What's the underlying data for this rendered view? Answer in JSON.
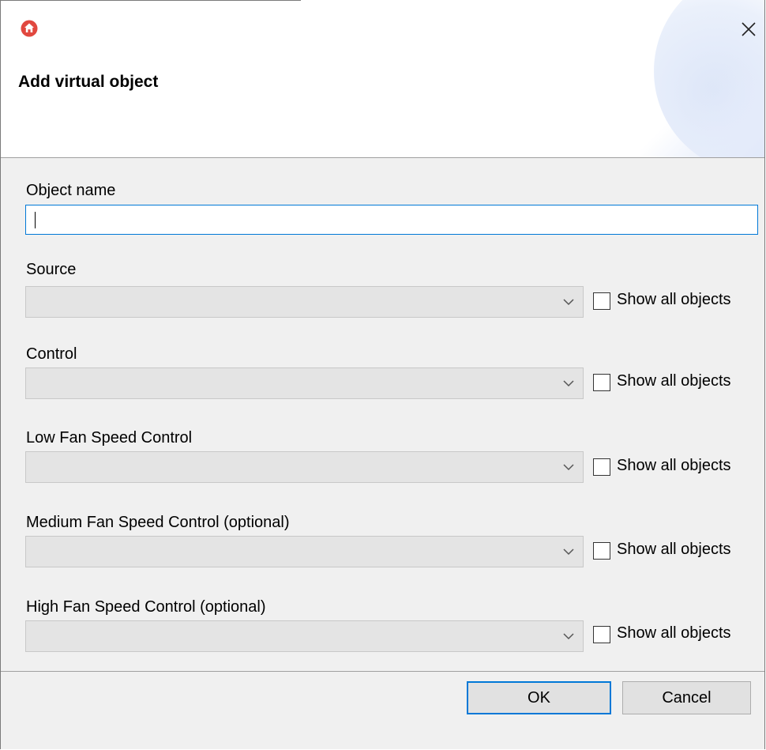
{
  "dialog": {
    "title": "Add virtual object",
    "close_glyph": "✕",
    "app_icon": "home-icon",
    "accent_color": "#e1483f"
  },
  "object_name": {
    "label": "Object name",
    "value": ""
  },
  "fields": [
    {
      "label": "Source",
      "value": "",
      "checkbox_label": "Show all objects",
      "checked": false
    },
    {
      "label": "Control",
      "value": "",
      "checkbox_label": "Show all objects",
      "checked": false
    },
    {
      "label": "Low Fan Speed Control",
      "value": "",
      "checkbox_label": "Show all objects",
      "checked": false
    },
    {
      "label": "Medium Fan Speed Control (optional)",
      "value": "",
      "checkbox_label": "Show all objects",
      "checked": false
    },
    {
      "label": "High Fan Speed Control (optional)",
      "value": "",
      "checkbox_label": "Show all objects",
      "checked": false
    }
  ],
  "buttons": {
    "ok": "OK",
    "cancel": "Cancel"
  }
}
